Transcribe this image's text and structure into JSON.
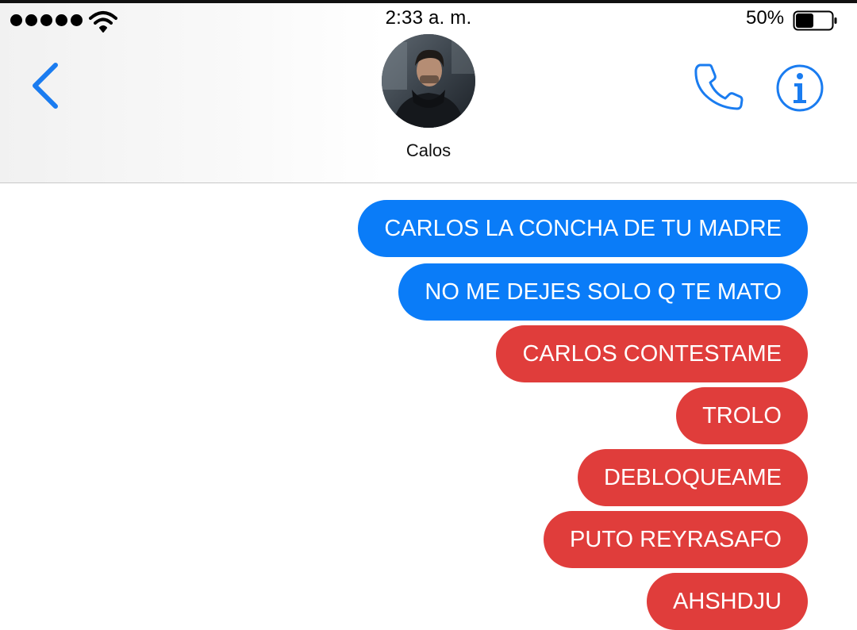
{
  "status_bar": {
    "time": "2:33 a. m.",
    "battery_percent": "50%",
    "battery_level": 0.5,
    "signal_dots": 5
  },
  "header": {
    "contact_name": "Calos",
    "back_icon": "chevron-left-icon",
    "call_icon": "phone-icon",
    "info_icon": "info-icon",
    "accent_color": "#1a7cf0"
  },
  "messages": [
    {
      "text": "CARLOS LA CONCHA DE TU MADRE",
      "status": "sent",
      "color": "#0a7cf8"
    },
    {
      "text": "NO ME DEJES SOLO Q TE MATO",
      "status": "sent",
      "color": "#0a7cf8"
    },
    {
      "text": "CARLOS CONTESTAME",
      "status": "failed",
      "color": "#e03d3b"
    },
    {
      "text": "TROLO",
      "status": "failed",
      "color": "#e03d3b"
    },
    {
      "text": "DEBLOQUEAME",
      "status": "failed",
      "color": "#e03d3b"
    },
    {
      "text": "PUTO REYRASAFO",
      "status": "failed",
      "color": "#e03d3b"
    },
    {
      "text": "AHSHDJU",
      "status": "failed",
      "color": "#e03d3b"
    }
  ]
}
